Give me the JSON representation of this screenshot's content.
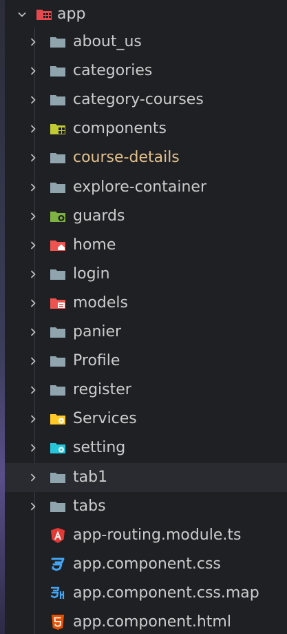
{
  "explorer": {
    "root": {
      "label": "app",
      "expanded": true,
      "icon": "folder-app-icon",
      "color": "#e5484d"
    },
    "items": [
      {
        "label": "about_us",
        "type": "folder",
        "icon": "folder-icon"
      },
      {
        "label": "categories",
        "type": "folder",
        "icon": "folder-icon"
      },
      {
        "label": "category-courses",
        "type": "folder",
        "icon": "folder-icon"
      },
      {
        "label": "components",
        "type": "folder",
        "icon": "folder-components-icon"
      },
      {
        "label": "course-details",
        "type": "folder",
        "icon": "folder-icon",
        "modified": true
      },
      {
        "label": "explore-container",
        "type": "folder",
        "icon": "folder-icon"
      },
      {
        "label": "guards",
        "type": "folder",
        "icon": "folder-guards-icon"
      },
      {
        "label": "home",
        "type": "folder",
        "icon": "folder-home-icon"
      },
      {
        "label": "login",
        "type": "folder",
        "icon": "folder-icon"
      },
      {
        "label": "models",
        "type": "folder",
        "icon": "folder-models-icon"
      },
      {
        "label": "panier",
        "type": "folder",
        "icon": "folder-icon"
      },
      {
        "label": "Profile",
        "type": "folder",
        "icon": "folder-icon"
      },
      {
        "label": "register",
        "type": "folder",
        "icon": "folder-icon"
      },
      {
        "label": "Services",
        "type": "folder",
        "icon": "folder-services-icon"
      },
      {
        "label": "setting",
        "type": "folder",
        "icon": "folder-settings-icon"
      },
      {
        "label": "tab1",
        "type": "folder",
        "icon": "folder-icon",
        "hovered": true
      },
      {
        "label": "tabs",
        "type": "folder",
        "icon": "folder-icon"
      },
      {
        "label": "app-routing.module.ts",
        "type": "file",
        "icon": "angular-icon"
      },
      {
        "label": "app.component.css",
        "type": "file",
        "icon": "css-icon"
      },
      {
        "label": "app.component.css.map",
        "type": "file",
        "icon": "css-map-icon"
      },
      {
        "label": "app.component.html",
        "type": "file",
        "icon": "html-icon"
      }
    ]
  },
  "colors": {
    "folder": "#90a4ae",
    "components": "#c0ca33",
    "guards": "#7cb342",
    "home": "#ef5350",
    "models": "#ef5350",
    "services": "#ffca28",
    "settings": "#26c6da",
    "angular": "#e53935",
    "css": "#42a5f5",
    "html": "#e65100",
    "modified_text": "#e2c08d"
  }
}
